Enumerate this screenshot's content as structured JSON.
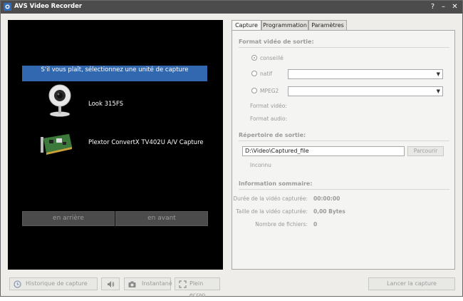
{
  "window": {
    "title": "AVS Video Recorder",
    "help": "?",
    "minimize": "–",
    "close": "✕"
  },
  "left": {
    "prompt": "S'il vous plaît, sélectionnez une unité de capture",
    "devices": [
      {
        "name": "Look 315FS",
        "icon": "webcam-icon"
      },
      {
        "name": "Plextor ConvertX TV402U A/V Capture",
        "icon": "capture-card-icon"
      }
    ],
    "back": "en arrière",
    "forward": "en avant"
  },
  "tabs": [
    {
      "label": "Capture",
      "active": true
    },
    {
      "label": "Programmation",
      "active": false
    },
    {
      "label": "Paramètres",
      "active": false
    }
  ],
  "format": {
    "title": "Format vidéo de sortie:",
    "options": [
      "conseillé",
      "natif",
      "MPEG2"
    ],
    "selected": "conseillé",
    "video_label": "Format vidéo:",
    "audio_label": "Format audio:"
  },
  "output": {
    "title": "Répertoire de sortie:",
    "path": "D:\\Video\\Captured_file",
    "browse": "Parcourir",
    "status": "Inconnu"
  },
  "summary": {
    "title": "Information sommaire:",
    "rows": [
      {
        "label": "Durée de la vidéo capturée:",
        "value": "00:00:00"
      },
      {
        "label": "Taille de la vidéo capturée:",
        "value": "0,00 Bytes"
      },
      {
        "label": "Nombre de fichiers:",
        "value": "0"
      }
    ]
  },
  "bottom": {
    "history": "Historique de capture",
    "snapshot": "Instantané",
    "fullscreen": "Plein ecran",
    "start": "Lancer la capture"
  }
}
